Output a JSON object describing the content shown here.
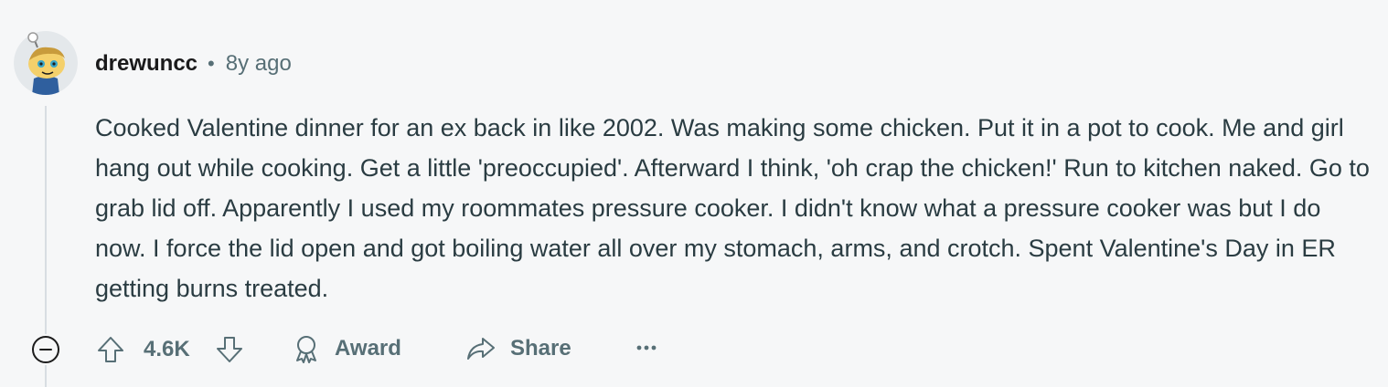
{
  "comment": {
    "username": "drewuncc",
    "separator": "•",
    "time_ago": "8y ago",
    "body": "Cooked Valentine dinner for an ex back in like 2002. Was making some chicken. Put it in a pot to cook. Me and girl hang out while cooking. Get a little 'preoccupied'. Afterward I think, 'oh crap the chicken!' Run to kitchen naked. Go to grab lid off. Apparently I used my roommates pressure cooker. I didn't know what a pressure cooker was but I do now. I force the lid open and got boiling water all over my stomach, arms, and crotch. Spent Valentine's Day in ER getting burns treated."
  },
  "actions": {
    "vote_count": "4.6K",
    "award_label": "Award",
    "share_label": "Share",
    "more_glyph": "•••"
  },
  "icons": {
    "collapse": "minus-circle-icon",
    "upvote": "upvote-arrow-icon",
    "downvote": "downvote-arrow-icon",
    "award": "award-ribbon-icon",
    "share": "share-arrow-icon",
    "more": "ellipsis-icon",
    "avatar": "snoo-avatar"
  },
  "colors": {
    "background": "#f6f7f8",
    "username": "#1a1a1b",
    "meta": "#576f76",
    "body_text": "#2a3c42",
    "thread_line": "#d8dde2"
  }
}
